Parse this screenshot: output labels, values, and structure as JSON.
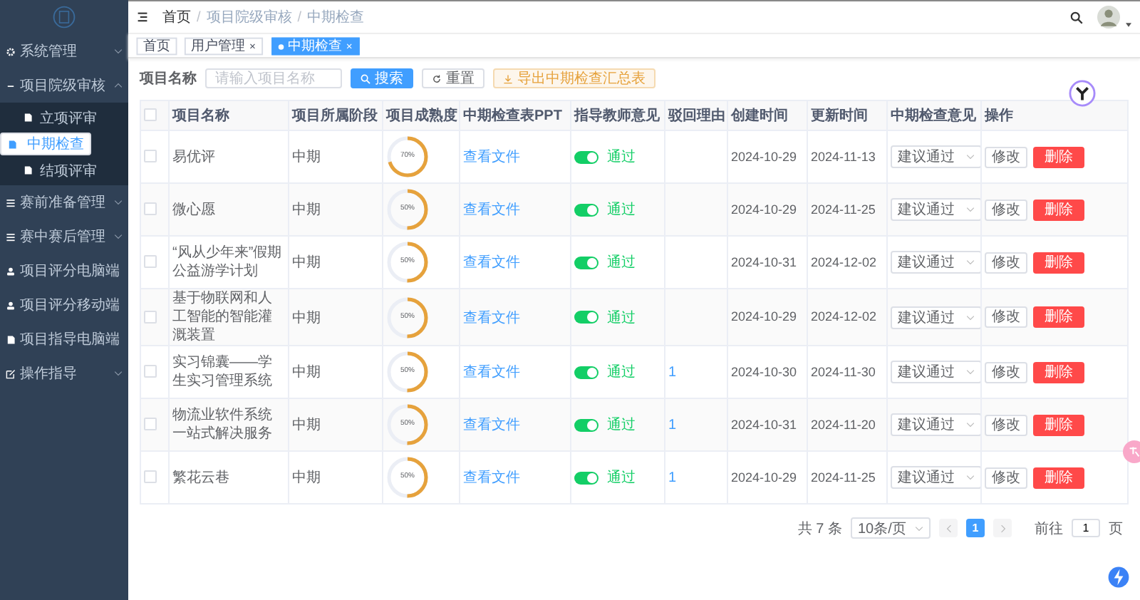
{
  "sidebar": {
    "items": [
      {
        "label": "系统管理",
        "kind": "group",
        "expanded": false,
        "selected": false
      },
      {
        "label": "项目院级审核",
        "kind": "group",
        "expanded": true,
        "selected": false,
        "children": [
          {
            "label": "立项评审",
            "selected": false
          },
          {
            "label": "中期检查",
            "selected": true
          },
          {
            "label": "结项评审",
            "selected": false
          }
        ]
      },
      {
        "label": "赛前准备管理",
        "kind": "group",
        "expanded": false,
        "selected": false
      },
      {
        "label": "赛中赛后管理",
        "kind": "group",
        "expanded": false,
        "selected": false
      },
      {
        "label": "项目评分电脑端",
        "kind": "link",
        "selected": false
      },
      {
        "label": "项目评分移动端",
        "kind": "link",
        "selected": false
      },
      {
        "label": "项目指导电脑端",
        "kind": "link",
        "selected": false
      },
      {
        "label": "操作指导",
        "kind": "group",
        "expanded": false,
        "selected": false
      }
    ]
  },
  "breadcrumb": [
    {
      "label": "首页",
      "kind": "link"
    },
    {
      "label": "/",
      "kind": "separator"
    },
    {
      "label": "项目院级审核",
      "kind": "link"
    },
    {
      "label": "/",
      "kind": "separator"
    },
    {
      "label": "中期检查",
      "kind": "current"
    }
  ],
  "tabs": [
    {
      "label": "首页",
      "selected": false
    },
    {
      "label": "用户管理",
      "close": "×",
      "selected": false
    },
    {
      "label": "中期检查",
      "close": "×",
      "selected": true
    }
  ],
  "search": {
    "label": "项目名称",
    "placeholder": "请输入项目名称",
    "buttons": [
      {
        "label": "搜索",
        "kind": "primary"
      },
      {
        "label": "重置",
        "kind": "default"
      },
      {
        "label": "导出中期检查汇总表",
        "kind": "warning"
      }
    ]
  },
  "table": {
    "columns": [
      "项目名称",
      "项目所属阶段",
      "项目成熟度",
      "中期检查表PPT",
      "指导教师意见",
      "驳回理由",
      "创建时间",
      "更新时间",
      "中期检查意见",
      "操作"
    ],
    "header_checked": false,
    "rows": [
      {
        "checked": false,
        "name": "易优评",
        "stage": "中期",
        "level": 0.7,
        "percent": "70%",
        "ppt": "查看文件",
        "approved": true,
        "status": "通过",
        "created": "2024-10-29",
        "updated": "2024-11-13",
        "opinion": "建议通过",
        "edit": "修改",
        "delete": "删除"
      },
      {
        "checked": false,
        "name": "微心愿",
        "stage": "中期",
        "level": 0.5,
        "percent": "50%",
        "ppt": "查看文件",
        "approved": true,
        "status": "通过",
        "created": "2024-10-29",
        "updated": "2024-11-25",
        "opinion": "建议通过",
        "edit": "修改",
        "delete": "删除"
      },
      {
        "checked": false,
        "name": "“风从少年来”假期公益游学计划",
        "stage": "中期",
        "level": 0.5,
        "percent": "50%",
        "ppt": "查看文件",
        "approved": true,
        "status": "通过",
        "created": "2024-10-31",
        "updated": "2024-12-02",
        "opinion": "建议通过",
        "edit": "修改",
        "delete": "删除"
      },
      {
        "checked": false,
        "name": "基于物联网和人工智能的智能灌溉装置",
        "stage": "中期",
        "level": 0.5,
        "percent": "50%",
        "ppt": "查看文件",
        "approved": true,
        "status": "通过",
        "created": "2024-10-29",
        "updated": "2024-12-02",
        "opinion": "建议通过",
        "edit": "修改",
        "delete": "删除"
      },
      {
        "checked": false,
        "name": "实习锦囊——学生实习管理系统",
        "stage": "中期",
        "level": 0.5,
        "percent": "50%",
        "ppt": "查看文件",
        "approved": true,
        "status": "通过",
        "reason": "1",
        "created": "2024-10-30",
        "updated": "2024-11-30",
        "opinion": "建议通过",
        "edit": "修改",
        "delete": "删除"
      },
      {
        "checked": false,
        "name": "物流业软件系统一站式解决服务",
        "stage": "中期",
        "level": 0.5,
        "percent": "50%",
        "ppt": "查看文件",
        "approved": true,
        "status": "通过",
        "reason": "1",
        "created": "2024-10-31",
        "updated": "2024-11-20",
        "opinion": "建议通过",
        "edit": "修改",
        "delete": "删除"
      },
      {
        "checked": false,
        "name": "繁花云巷",
        "stage": "中期",
        "level": 0.5,
        "percent": "50%",
        "ppt": "查看文件",
        "approved": true,
        "status": "通过",
        "reason": "1",
        "created": "2024-10-29",
        "updated": "2024-11-25",
        "opinion": "建议通过",
        "edit": "修改",
        "delete": "删除"
      }
    ]
  },
  "pagination": {
    "total": "共 7 条",
    "page_size": "10条/页",
    "pages": [
      {
        "label": "1",
        "selected": true
      }
    ],
    "goto_label": "前往",
    "goto_value": "1",
    "goto_suffix": "页"
  }
}
